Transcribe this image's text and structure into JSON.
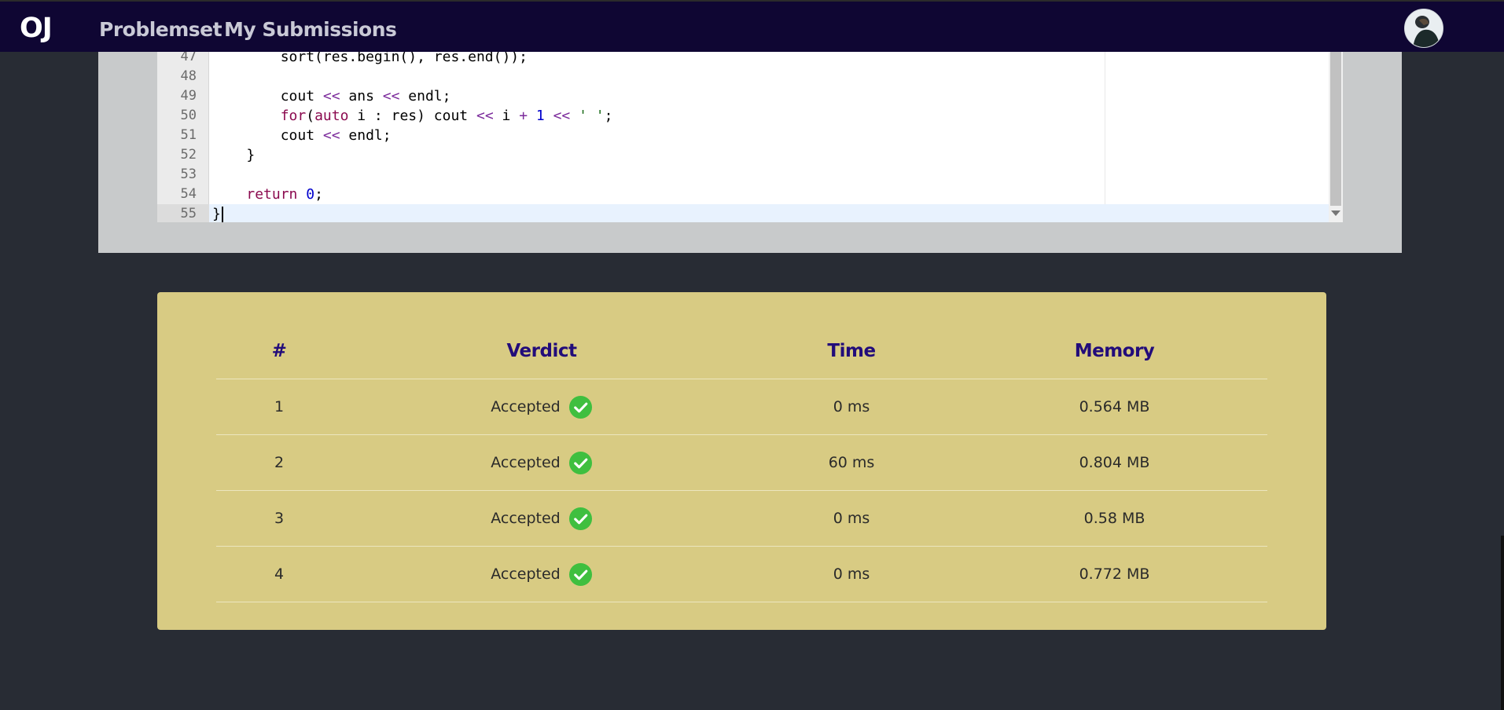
{
  "navbar": {
    "brand": "OJ",
    "links": [
      {
        "label": "Problemset"
      },
      {
        "label": "My Submissions"
      }
    ]
  },
  "editor": {
    "lines": [
      {
        "n": "47"
      },
      {
        "n": "48"
      },
      {
        "n": "49"
      },
      {
        "n": "50"
      },
      {
        "n": "51"
      },
      {
        "n": "52"
      },
      {
        "n": "53"
      },
      {
        "n": "54"
      },
      {
        "n": "55"
      }
    ],
    "code": {
      "l47_indent": "        ",
      "l47_text": "sort(res.begin(), res.end());",
      "l49_a": "        cout ",
      "l49_op1": "<<",
      "l49_b": " ans ",
      "l49_op2": "<<",
      "l49_c": " endl;",
      "l50_indent": "        ",
      "l50_for": "for",
      "l50_paren": "(",
      "l50_auto": "auto",
      "l50_a": " i : res) cout ",
      "l50_op1": "<<",
      "l50_b": " i ",
      "l50_plus": "+",
      "l50_sp": " ",
      "l50_one": "1",
      "l50_sp2": " ",
      "l50_op2": "<<",
      "l50_sp3": " ",
      "l50_str": "' '",
      "l50_end": ";",
      "l51_a": "        cout ",
      "l51_op": "<<",
      "l51_b": " endl;",
      "l52": "    }",
      "l54_indent": "    ",
      "l54_return": "return",
      "l54_sp": " ",
      "l54_zero": "0",
      "l54_end": ";",
      "l55": "}"
    }
  },
  "results": {
    "headers": {
      "num": "#",
      "verdict": "Verdict",
      "time": "Time",
      "memory": "Memory"
    },
    "rows": [
      {
        "num": "1",
        "verdict": "Accepted",
        "time": "0 ms",
        "memory": "0.564 MB"
      },
      {
        "num": "2",
        "verdict": "Accepted",
        "time": "60 ms",
        "memory": "0.804 MB"
      },
      {
        "num": "3",
        "verdict": "Accepted",
        "time": "0 ms",
        "memory": "0.58 MB"
      },
      {
        "num": "4",
        "verdict": "Accepted",
        "time": "0 ms",
        "memory": "0.772 MB"
      }
    ]
  },
  "colors": {
    "navbar": "#0f0633",
    "background": "#282c34",
    "card": "#d8cb83",
    "header_text": "#220c7a",
    "accepted_icon": "#3fbf3f"
  },
  "icons": {
    "verdict": "check-circle-icon",
    "avatar": "user-avatar"
  }
}
